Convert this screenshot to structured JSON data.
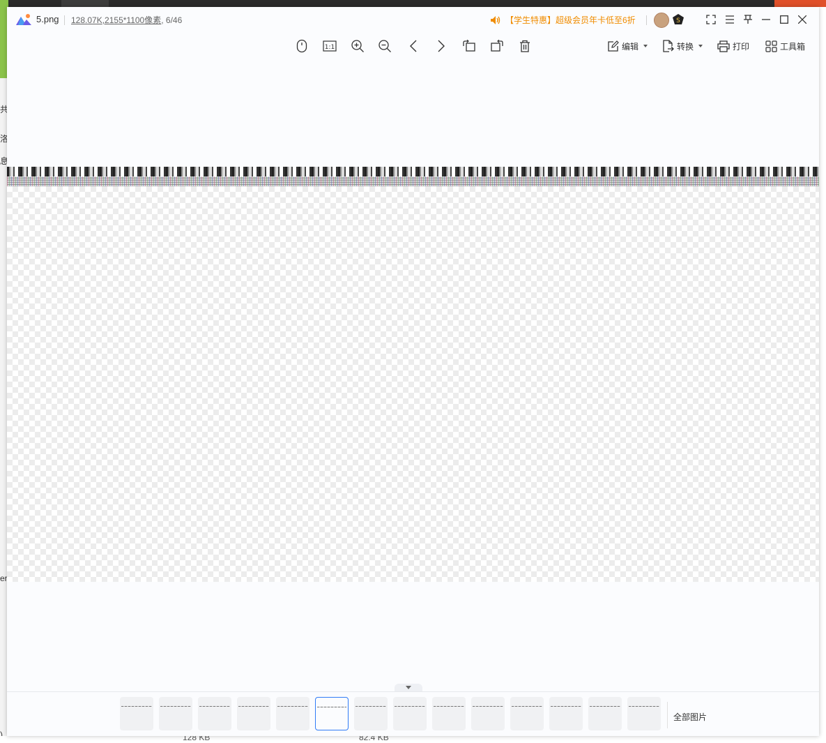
{
  "window": {
    "file_name": "5.png",
    "file_size": "128.07K",
    "dimensions": ",2155*1100像素",
    "position": ", 6/46",
    "promo_text": "【学生特惠】超级会员年卡低至6折"
  },
  "toolbar": {
    "edit_label": "编辑",
    "convert_label": "转换",
    "print_label": "打印",
    "toolbox_label": "工具箱",
    "actual_size_label": "1:1"
  },
  "filmstrip": {
    "thumbnail_count": 14,
    "active_index": 5,
    "all_images_label": "全部图片"
  },
  "background": {
    "left_chars": [
      "共",
      "洛",
      "息",
      "er",
      ")"
    ],
    "bottom_sizes": [
      "128 KB",
      "82.4 KB"
    ]
  },
  "colors": {
    "accent": "#2f7bf6",
    "promo": "#f08c00",
    "viewer_bg": "#fbfcfe"
  }
}
